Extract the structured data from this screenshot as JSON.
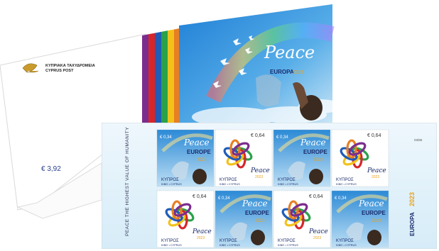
{
  "cover": {
    "logo_line1": "ΚΥΠΡΙΑΚΑ ΤΑΧΥΔΡΟΜΕΙΑ",
    "logo_line2": "CYPRUS POST",
    "price": "€ 3,92",
    "peace_word": "Peace",
    "europa_word": "EUROPA",
    "europa_year": "2023",
    "stripe_colors": [
      "#7b2d8e",
      "#d6262a",
      "#1f5cb8",
      "#2aa14a",
      "#f2c21b",
      "#e87f22"
    ],
    "sky_color": "#2f8fd8"
  },
  "sheet": {
    "side_slogan": "PEACE THE HIGHEST VALUE OF HUMANITY",
    "right_code": "2023",
    "europa_word": "EUROPA",
    "serial": "03/86",
    "stamps": [
      {
        "design": "peace",
        "value": "€ 0,34",
        "country": "ΚΥΠΡΟΣ",
        "country_sub": "ΚΙΒΙΣ • CYPRUS",
        "title": "Peace",
        "subtitle": "EUROPE",
        "year": "2023"
      },
      {
        "design": "knot",
        "value": "€ 0,64",
        "country": "ΚΥΠΡΟΣ",
        "country_sub": "ΚΙΒΙΣ • CYPRUS",
        "title": "Peace",
        "subtitle": "EUROPE",
        "year": "2023"
      },
      {
        "design": "peace",
        "value": "€ 0,34",
        "country": "ΚΥΠΡΟΣ",
        "country_sub": "ΚΙΒΙΣ • CYPRUS",
        "title": "Peace",
        "subtitle": "EUROPE",
        "year": "2023"
      },
      {
        "design": "knot",
        "value": "€ 0,64",
        "country": "ΚΥΠΡΟΣ",
        "country_sub": "ΚΙΒΙΣ • CYPRUS",
        "title": "Peace",
        "subtitle": "EUROPE",
        "year": "2023"
      },
      {
        "design": "knot",
        "value": "€ 0,64",
        "country": "ΚΥΠΡΟΣ",
        "country_sub": "ΚΙΒΙΣ • CYPRUS",
        "title": "Peace",
        "subtitle": "EUROPE",
        "year": "2023"
      },
      {
        "design": "peace",
        "value": "€ 0,34",
        "country": "ΚΥΠΡΟΣ",
        "country_sub": "ΚΙΒΙΣ • CYPRUS",
        "title": "Peace",
        "subtitle": "EUROPE",
        "year": "2023"
      },
      {
        "design": "knot",
        "value": "€ 0,64",
        "country": "ΚΥΠΡΟΣ",
        "country_sub": "ΚΙΒΙΣ • CYPRUS",
        "title": "Peace",
        "subtitle": "EUROPE",
        "year": "2023"
      },
      {
        "design": "peace",
        "value": "€ 0,34",
        "country": "ΚΥΠΡΟΣ",
        "country_sub": "ΚΙΒΙΣ • CYPRUS",
        "title": "Peace",
        "subtitle": "EUROPE",
        "year": "2023"
      }
    ]
  }
}
